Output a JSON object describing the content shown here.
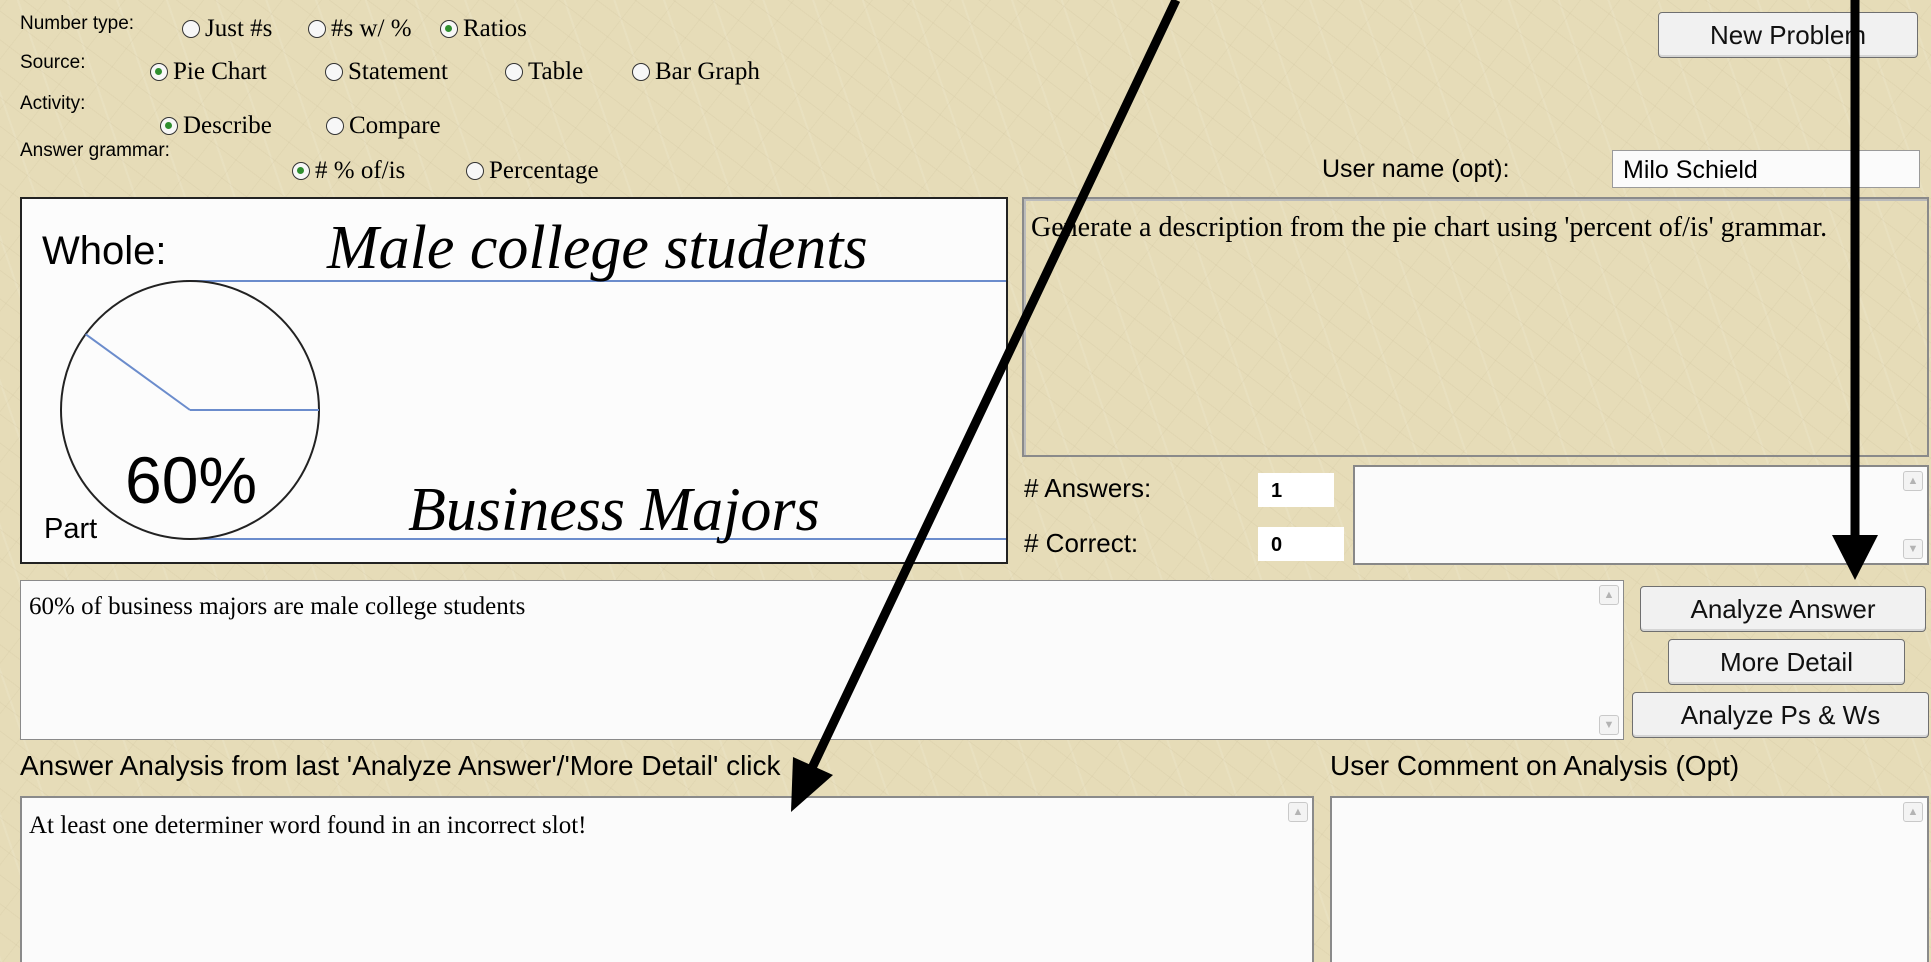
{
  "options": {
    "number_type": {
      "label": "Number type:",
      "choices": [
        "Just #s",
        "#s w/ %",
        "Ratios"
      ],
      "selected": "Ratios"
    },
    "source": {
      "label": "Source:",
      "choices": [
        "Pie Chart",
        "Statement",
        "Table",
        "Bar Graph"
      ],
      "selected": "Pie Chart"
    },
    "activity": {
      "label": "Activity:",
      "choices": [
        "Describe",
        "Compare"
      ],
      "selected": "Describe"
    },
    "answer_grammar": {
      "label": "Answer grammar:",
      "choices": [
        "# % of/is",
        "Percentage"
      ],
      "selected": "# % of/is"
    }
  },
  "new_problem_label": "New Problem",
  "user": {
    "label": "User name (opt):",
    "value": "Milo Schield"
  },
  "pie": {
    "whole_label": "Whole:",
    "whole_value": "Male college students",
    "part_label": "Part",
    "percent_text": "60%",
    "part_value": "Business Majors",
    "percent": 60
  },
  "instruction": "Generate a description from the pie chart using 'percent of/is' grammar.",
  "stats": {
    "answers_label": "# Answers:",
    "answers_value": "1",
    "correct_label": "# Correct:",
    "correct_value": "0"
  },
  "answer_text": "60% of business majors are male college students",
  "buttons": {
    "analyze_answer": "Analyze Answer",
    "more_detail": "More Detail",
    "analyze_ps_ws": "Analyze Ps & Ws"
  },
  "analysis": {
    "heading": "Answer Analysis from last 'Analyze Answer'/'More Detail' click",
    "text": "At least one determiner word found in an incorrect slot!"
  },
  "comment": {
    "heading": "User Comment on Analysis (Opt)",
    "text": ""
  },
  "colors": {
    "background": "#e6dcb8",
    "radio_selected": "#2f8f2f",
    "guide_line": "#6b8ccc",
    "arrow": "#000000"
  }
}
